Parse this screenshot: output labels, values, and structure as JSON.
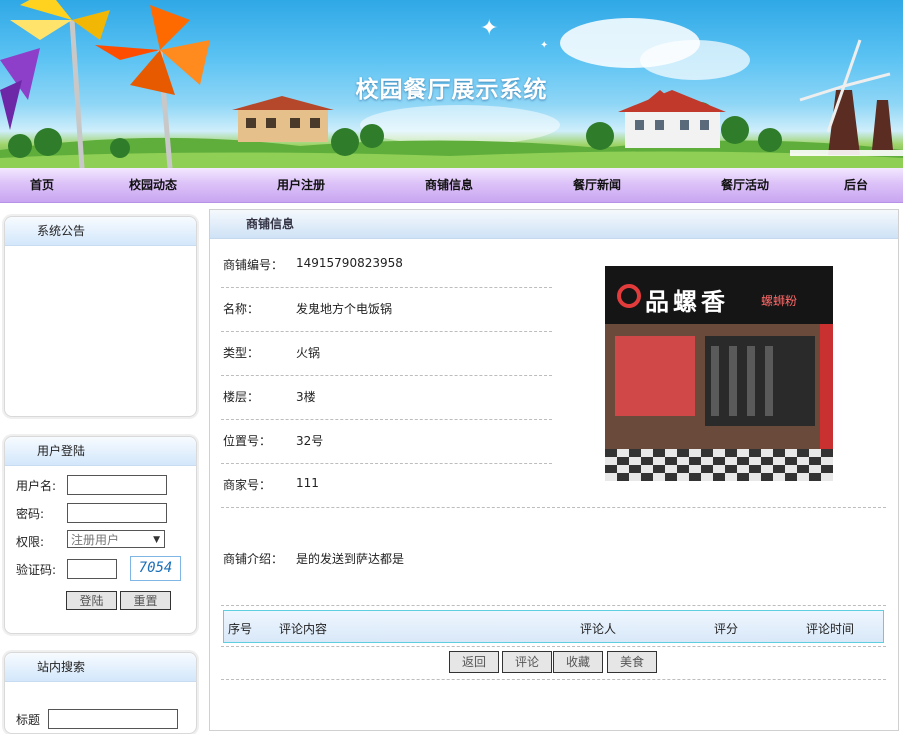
{
  "banner": {
    "title": "校园餐厅展示系统"
  },
  "nav": {
    "items": [
      "首页",
      "校园动态",
      "用户注册",
      "商铺信息",
      "餐厅新闻",
      "餐厅活动",
      "后台"
    ]
  },
  "sidebar": {
    "notice": {
      "title": "系统公告"
    },
    "login": {
      "title": "用户登陆",
      "username_label": "用户名:",
      "password_label": "密码:",
      "role_label": "权限:",
      "role_selected": "注册用户",
      "captcha_label": "验证码:",
      "captcha_code": "7054",
      "login_button": "登陆",
      "reset_button": "重置"
    },
    "search": {
      "title": "站内搜索",
      "field_label": "标题"
    }
  },
  "shop": {
    "section_title": "商铺信息",
    "fields": [
      {
        "label": "商铺编号：",
        "value": "14915790823958"
      },
      {
        "label": "名称：",
        "value": "发鬼地方个电饭锅"
      },
      {
        "label": "类型：",
        "value": "火锅"
      },
      {
        "label": "楼层：",
        "value": "3楼"
      },
      {
        "label": "位置号：",
        "value": "32号"
      },
      {
        "label": "商家号：",
        "value": "111"
      }
    ],
    "intro_label": "商铺介绍：",
    "intro_value": "是的发送到萨达都是",
    "photo": {
      "sign_text": "品螺香",
      "sign_sub": "螺蛳粉"
    }
  },
  "comments": {
    "columns": [
      "序号",
      "评论内容",
      "评论人",
      "评分",
      "评论时间"
    ]
  },
  "actions": [
    "返回",
    "评论",
    "收藏",
    "美食"
  ],
  "colors": {
    "nav_purple": "#c9a6f1",
    "panel_blue": "#d3e7fb",
    "comment_border": "#5fcfe0"
  }
}
